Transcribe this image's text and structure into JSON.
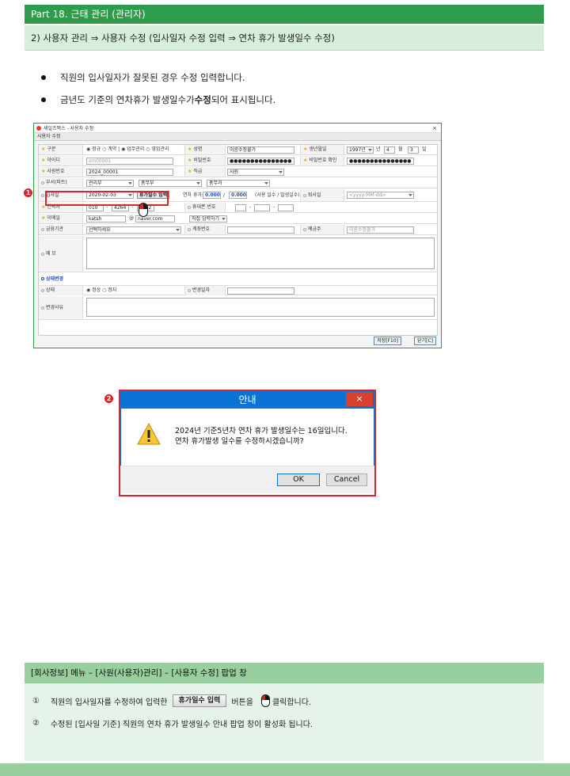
{
  "header": {
    "part_title": "Part 18. 근태 관리 (관리자)",
    "subtitle": "2) 사용자 관리 ⇒ 사용자 수정 (입사일자 수정 입력 ⇒ 연차 휴가 발생일수 수정)"
  },
  "bullets": [
    {
      "pre": "직원의 입사일자가 잘못된 경우 수정 입력합니다.",
      "bold": "",
      "post": ""
    },
    {
      "pre": "금년도 기준의 연차휴가 발생일수가 ",
      "bold": "수정",
      "post": "되어 표시됩니다."
    }
  ],
  "window": {
    "title": "세일즈맥스 - 사용자 수정",
    "tab": "사용자 수정",
    "fields": {
      "type_label": "구분",
      "type_options": "◉ 정규 ○ 계약  |  ◉ 업무관리 ○ 영업관리",
      "name_label": "성명",
      "name_value": "이름수정불가",
      "birth_label": "생년월일",
      "birth_year": "1997년",
      "birth_year_suffix": "년",
      "birth_month": "4",
      "birth_month_suffix": "월",
      "birth_day": "3",
      "birth_day_suffix": "일",
      "id_label": "아이디",
      "id_value": "sm00001",
      "pw_label": "비밀번호",
      "pw_value": "●●●●●●●●●●●●●●●",
      "pw_confirm_label": "비밀번호 확인",
      "pw_confirm_value": "●●●●●●●●●●●●●●●",
      "empno_label": "사원번호",
      "empno_value": "2024_00001",
      "rank_label": "직급",
      "rank_value": "사원",
      "dept_label": "부서(파트)",
      "dept1": "관리부",
      "dept2": "총무부",
      "dept3": "총무과",
      "join_label": "입사일",
      "join_value": "2020-02-03",
      "vacation_button": "휴가일수 입력",
      "annual_label": "연차 휴가:",
      "annual_a": "0.000",
      "annual_sep": "/",
      "annual_b": "0.000",
      "annual_note": "(사용 일수 / 발생일수)",
      "leave_label": "퇴사일",
      "leave_value": "<yyyy-MM-dd>",
      "contact_label": "연락처",
      "contact1": "010",
      "contact_sep1": "-",
      "contact2": "4264",
      "contact_sep2": "-",
      "contact3": "7942",
      "mobile_label": "휴대폰 번호",
      "mobile_sep1": "-",
      "mobile_sep2": "-",
      "email_label": "이메일",
      "email_id": "katsh",
      "email_at": "@",
      "email_domain": "naver.com",
      "email_direct": "직접 입력하기",
      "bank_label": "금융기관",
      "bank_value": "선택하세요",
      "account_label": "계좌번호",
      "holder_label": "예금주",
      "holder_value": "이름수정불가",
      "memo_label": "메 모",
      "status_section": "상태변경",
      "status_label": "상태",
      "status_options": "◉ 정상 ○ 정지",
      "change_date_label": "변경일자",
      "change_reason_label": "변경사유"
    },
    "save_button": "저장[F10]",
    "close_button": "닫기[C]"
  },
  "badges": {
    "one": "1",
    "two": "2"
  },
  "dialog": {
    "title": "안내",
    "close": "×",
    "line1": "2024년 기준5년차 연차 휴가 발생일수는 16일입니다.",
    "line2": "연차 휴가발생 일수를 수정하시겠습니까?",
    "ok": "OK",
    "cancel": "Cancel"
  },
  "note": {
    "head": "[회사정보] 메뉴 –  [사원(사용자)관리]  – [사용자 수정] 팝업 창",
    "line1_num": "①",
    "line1_pre": "직원의 입사일자를 수정하여 입력한",
    "line1_button": "휴가일수 입력",
    "line1_mid": "버튼을",
    "line1_post": "클릭합니다.",
    "line2_num": "②",
    "line2": "수정된 [입사일 기준] 직원의 연차 휴가 발생일수 안내 팝업 창이 활성화 됩니다."
  }
}
